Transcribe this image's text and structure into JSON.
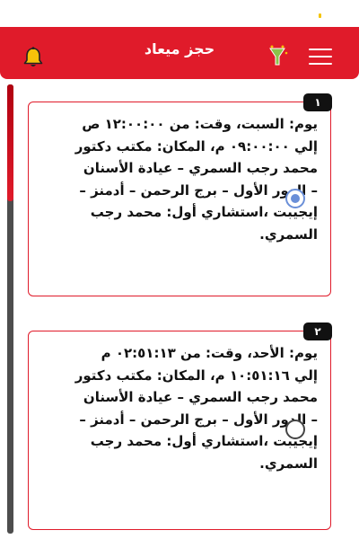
{
  "header": {
    "title": "حجز ميعاد",
    "accent_color": "#e01b2a",
    "icons": [
      "bell-icon",
      "flag-icon",
      "menu-icon"
    ]
  },
  "appointments": [
    {
      "number": "١",
      "text": "يوم: السبت، وقت: من ١٢:٠٠:٠٠ ص إلي ٠٩:٠٠:٠٠ م، المكان: مكتب دكتور محمد رجب السمري – عيادة الأسنان – الدور الأول – برج الرحمن – أدمنز – إيجيبت ،استشاري أول: محمد رجب السمري.",
      "selected": true
    },
    {
      "number": "٢",
      "text": "يوم: الأحد، وقت: من ٠٢:٥١:١٣ م إلي ١٠:٥١:١٦ م، المكان: مكتب دكتور محمد رجب السمري – عيادة الأسنان – الدور الأول – برج الرحمن – أدمنز – إيجيبت ،استشاري أول: محمد رجب السمري.",
      "selected": false
    }
  ],
  "scroll_position": 0.26
}
